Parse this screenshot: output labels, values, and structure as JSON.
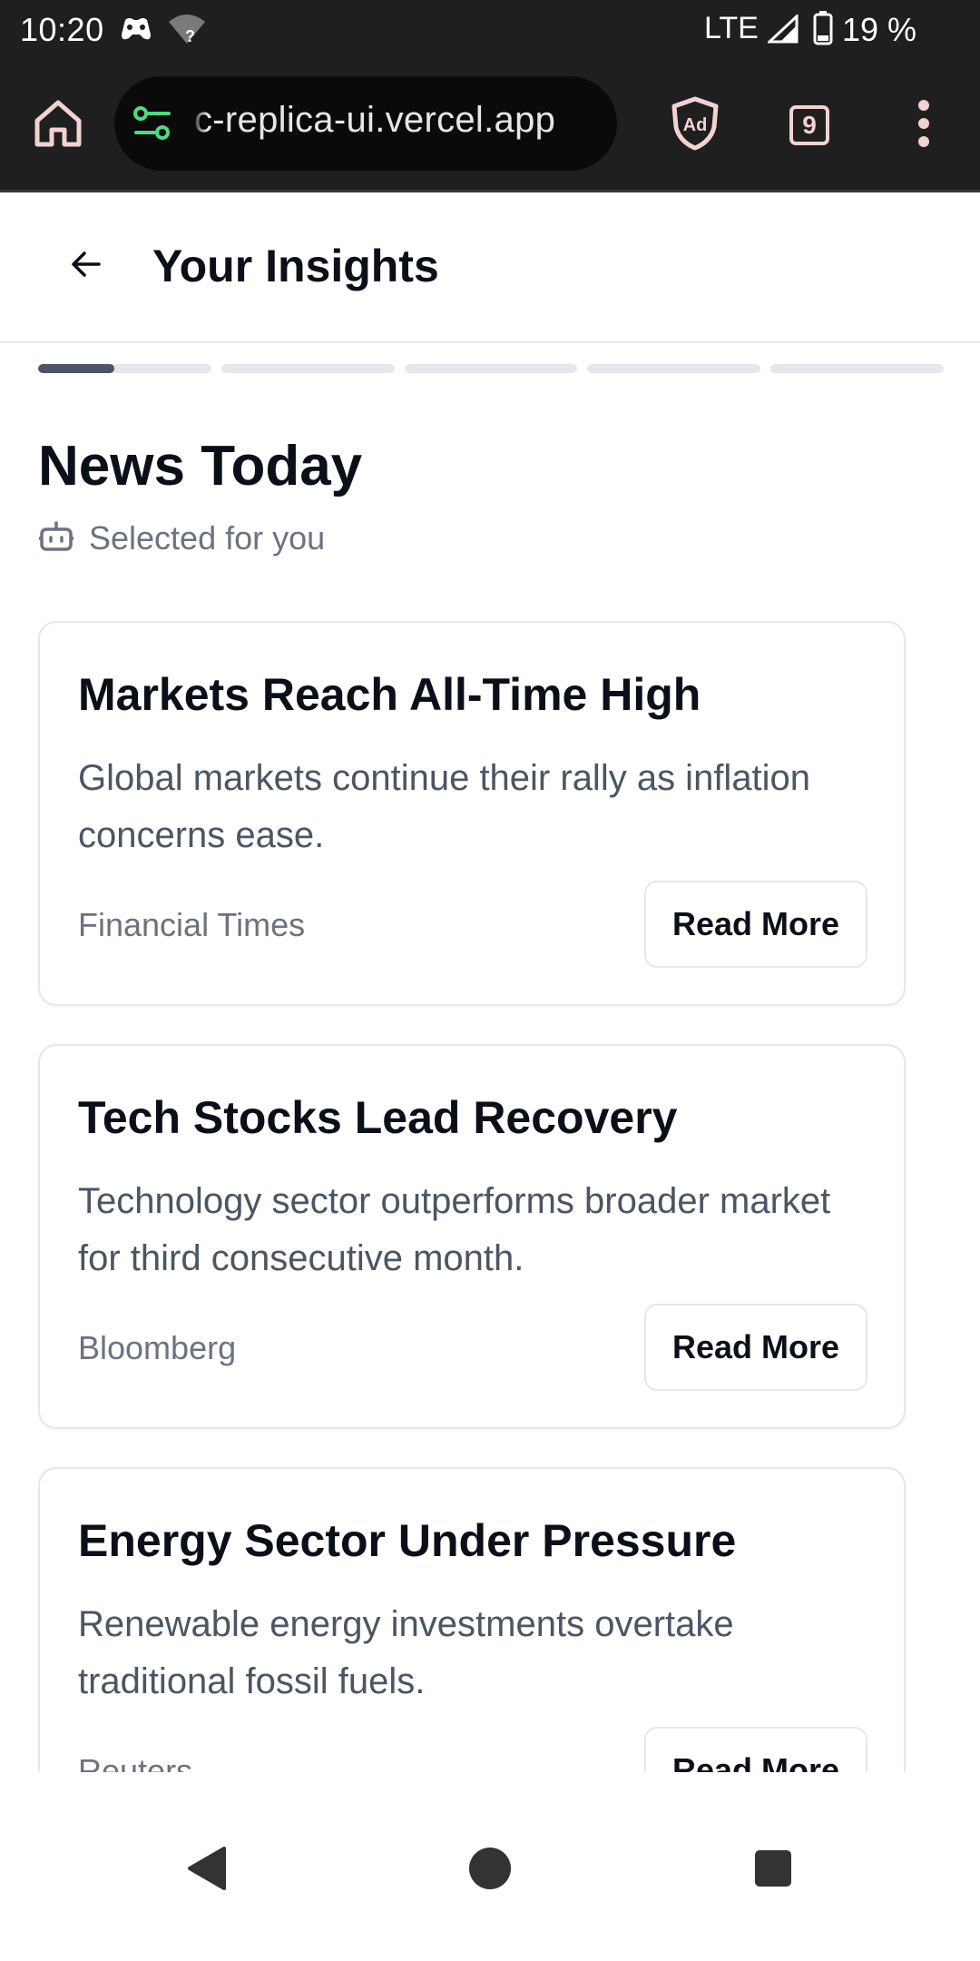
{
  "status_bar": {
    "time": "10:20",
    "network": "LTE",
    "battery_text": "19 %",
    "icons": [
      "game-controller-icon",
      "wifi-unknown-icon",
      "signal-icon",
      "battery-icon"
    ]
  },
  "browser": {
    "url": "c-replica-ui.vercel.app",
    "tab_count": "9",
    "icons": [
      "home-icon",
      "site-settings-icon",
      "adblock-shield-icon",
      "tabs-icon",
      "more-menu-icon"
    ]
  },
  "header": {
    "title": "Your Insights",
    "back_icon": "arrow-left-icon"
  },
  "progress": {
    "segments_total": 5,
    "current_segment_fill": 0.44
  },
  "section": {
    "title": "News Today",
    "subtitle": "Selected for you",
    "subtitle_icon": "robot-icon"
  },
  "articles": [
    {
      "title": "Markets Reach All-Time High",
      "summary": "Global markets continue their rally as inflation concerns ease.",
      "source": "Financial Times",
      "button": "Read More"
    },
    {
      "title": "Tech Stocks Lead Recovery",
      "summary": "Technology sector outperforms broader market for third consecutive month.",
      "source": "Bloomberg",
      "button": "Read More"
    },
    {
      "title": "Energy Sector Under Pressure",
      "summary": "Renewable energy investments overtake traditional fossil fuels.",
      "source": "Reuters",
      "button": "Read More"
    }
  ],
  "colors": {
    "status_bg": "#1f1f1f",
    "progress_active": "#4b5563",
    "progress_track": "#e5e7eb",
    "secure_icon": "#4ade80"
  }
}
